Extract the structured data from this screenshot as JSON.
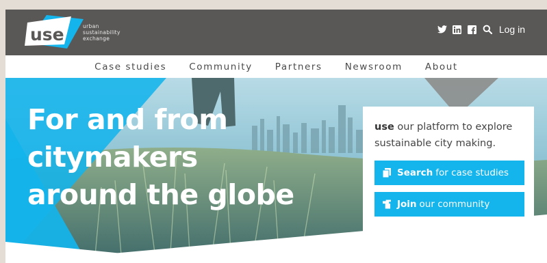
{
  "brand": {
    "logo_text": "use",
    "tagline": [
      "urban",
      "sustainability",
      "exchange"
    ]
  },
  "utility": {
    "icons": [
      "twitter-icon",
      "linkedin-icon",
      "facebook-icon",
      "search-icon"
    ],
    "login_label": "Log in"
  },
  "nav": {
    "items": [
      "Case studies",
      "Community",
      "Partners",
      "Newsroom",
      "About"
    ]
  },
  "hero": {
    "headline_lines": [
      "For and from",
      "citymakers",
      "around the globe"
    ]
  },
  "card": {
    "lead_bold": "use",
    "lead_text": " our platform to explore sustainable city making.",
    "cta_search_bold": "Search",
    "cta_search_text": "for case studies",
    "cta_join_bold": "Join",
    "cta_join_text": "our community"
  },
  "colors": {
    "header_bg": "#5a5857",
    "accent": "#14b4ec",
    "page_bg": "#e4ddd6"
  }
}
